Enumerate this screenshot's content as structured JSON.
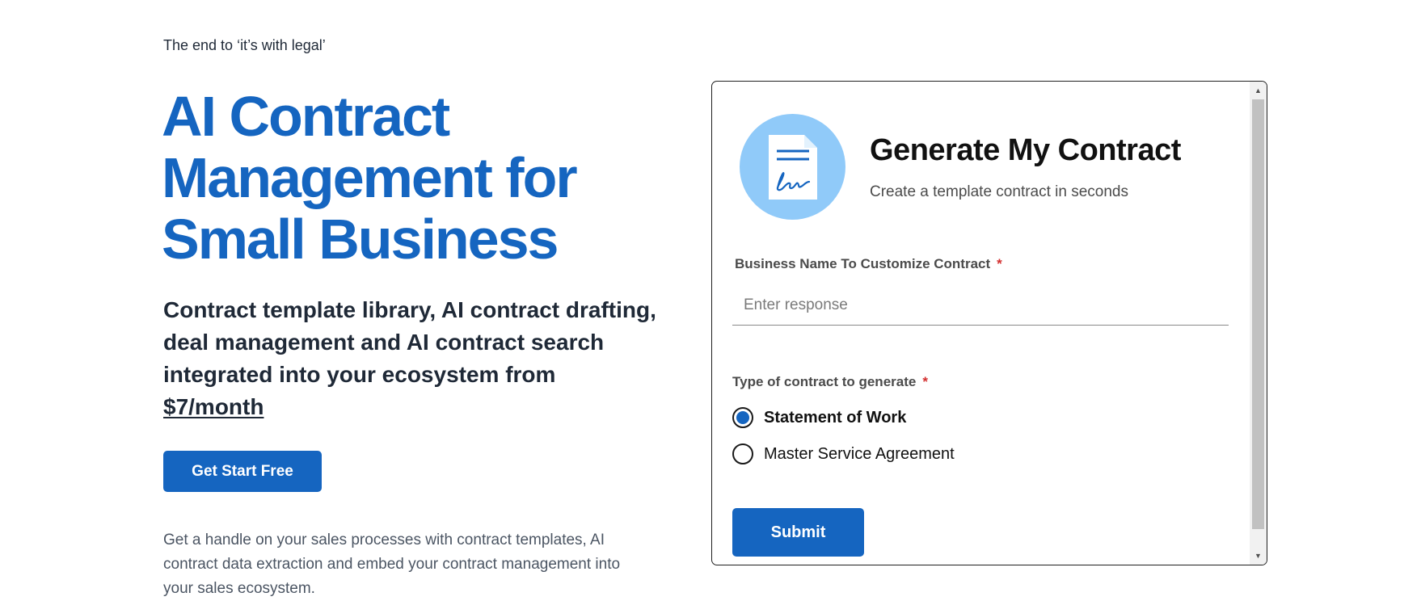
{
  "hero": {
    "eyebrow": "The end to ‘it’s with legal’",
    "title_lines": [
      "AI Contract",
      "Management for",
      "Small Business"
    ],
    "subhead_lines": [
      "Contract template library, AI contract drafting,",
      "deal management and AI contract search",
      "integrated into your ecosystem from"
    ],
    "price_link": "$7/month",
    "cta_label": "Get Start Free",
    "body_lines": [
      "Get a handle on your sales processes with contract templates, AI",
      "contract data extraction and embed your contract management into",
      "your sales ecosystem."
    ]
  },
  "form": {
    "avatar_icon": "document-signature-icon",
    "title": "Generate My Contract",
    "subtitle": "Create a template contract in seconds",
    "business_name": {
      "label": "Business Name To Customize Contract",
      "required_mark": "*",
      "placeholder": "Enter response",
      "value": ""
    },
    "contract_type": {
      "label": "Type of contract to generate",
      "required_mark": "*",
      "options": [
        {
          "label": "Statement of Work",
          "selected": true
        },
        {
          "label": "Master Service Agreement",
          "selected": false
        }
      ]
    },
    "submit_label": "Submit"
  },
  "colors": {
    "brand_blue": "#1565c0",
    "avatar_bg": "#90caf9",
    "required_red": "#d32f2f",
    "text_dark": "#1f2937"
  }
}
